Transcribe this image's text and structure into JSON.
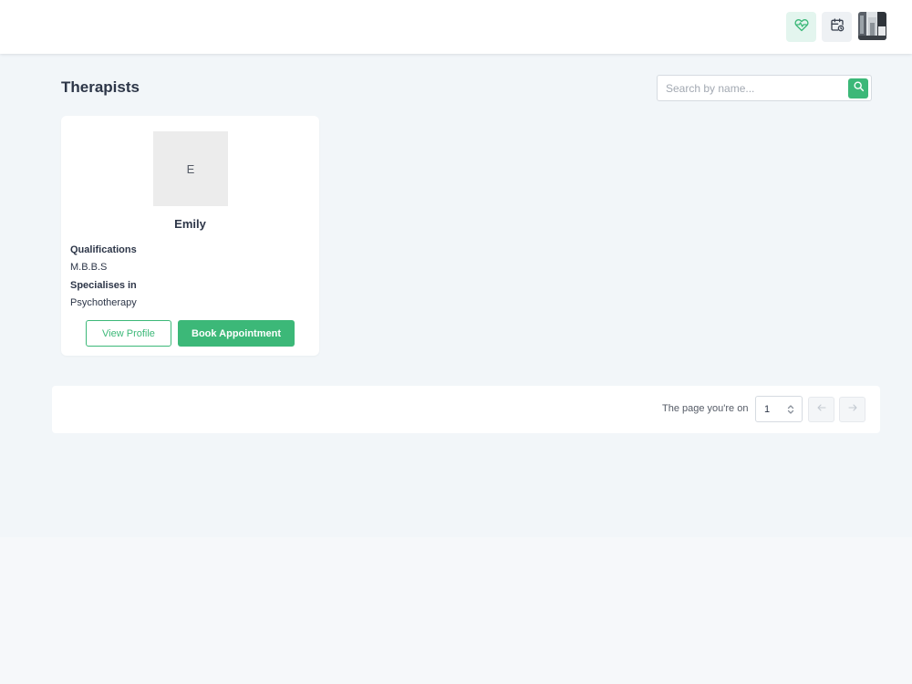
{
  "header": {
    "icons": [
      "heart-pulse-icon",
      "calendar-clock-icon"
    ],
    "colors": {
      "accent": "#3cb878",
      "accent_light": "#e3f5ee"
    }
  },
  "page": {
    "title": "Therapists",
    "search": {
      "placeholder": "Search by name...",
      "value": ""
    }
  },
  "therapists": [
    {
      "initial": "E",
      "name": "Emily",
      "qualifications_label": "Qualifications",
      "qualifications": "M.B.B.S",
      "specialises_label": "Specialises in",
      "specialisation": "Psychotherapy",
      "view_profile_label": "View Profile",
      "book_label": "Book Appointment"
    }
  ],
  "pagination": {
    "label": "The page you're on",
    "current_page": "1"
  }
}
